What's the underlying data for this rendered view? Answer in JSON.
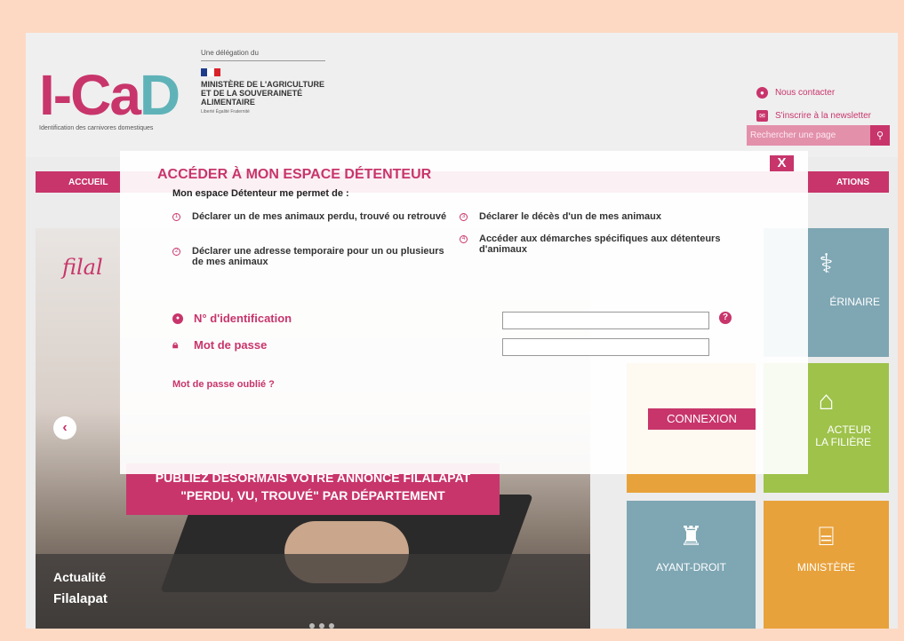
{
  "colors": {
    "brand": "#c8356b",
    "accent_teal": "#5fb3b8",
    "frame": "#fdd9c3"
  },
  "header": {
    "logo": {
      "text_main": "I-Ca",
      "text_accent": "D",
      "tagline": "Identification des carnivores domestiques"
    },
    "delegation": {
      "label": "Une délégation du",
      "ministry": "MINISTÈRE DE L'AGRICULTURE ET DE LA SOUVERAINETÉ ALIMENTAIRE",
      "motto": "Liberté Égalité Fraternité"
    },
    "links": [
      {
        "label": "Nous contacter",
        "icon": "chat-icon"
      },
      {
        "label": "S'inscrire à la newsletter",
        "icon": "mail-icon"
      }
    ],
    "search": {
      "placeholder": "Rechercher une page",
      "icon": "search-icon"
    }
  },
  "nav": {
    "first": "ACCUEIL",
    "last": "ATIONS"
  },
  "carousel": {
    "script_text": "filal",
    "banner_line1": "PUBLIEZ DÉSORMAIS VOTRE ANNONCE FILALAPAT",
    "banner_line2": "\"PERDU, VU, TROUVÉ\" PAR DÉPARTEMENT",
    "caption_category": "Actualité",
    "caption_title": "Filalapat",
    "slides_count": 3
  },
  "tiles": [
    {
      "label": "ÉRINAIRE",
      "icon": "stethoscope-icon"
    },
    {
      "label": "ACTEUR\nLA FILIÈRE",
      "icon": "home-heart-icon"
    },
    {
      "label": "AYANT-DROIT",
      "icon": "beacon-icon"
    },
    {
      "label": "MINISTÈRE",
      "icon": "institution-icon"
    }
  ],
  "modal": {
    "title": "ACCÉDER À MON ESPACE DÉTENTEUR",
    "close_label": "X",
    "intro": "Mon espace Détenteur me permet de :",
    "features": [
      {
        "num": "1",
        "text": "Déclarer un de mes animaux perdu, trouvé ou retrouvé"
      },
      {
        "num": "2",
        "text": "Déclarer une adresse temporaire pour un ou plusieurs de mes animaux"
      },
      {
        "num": "3",
        "text": "Déclarer le décès d'un de mes animaux"
      },
      {
        "num": "4",
        "text": "Accéder aux démarches spécifiques aux détenteurs d'animaux"
      }
    ],
    "id_label": "N° d'identification",
    "id_value": "",
    "password_label": "Mot de passe",
    "password_value": "",
    "help_label": "?",
    "forgot_label": "Mot de passe oublié ?",
    "submit_label": "CONNEXION"
  }
}
